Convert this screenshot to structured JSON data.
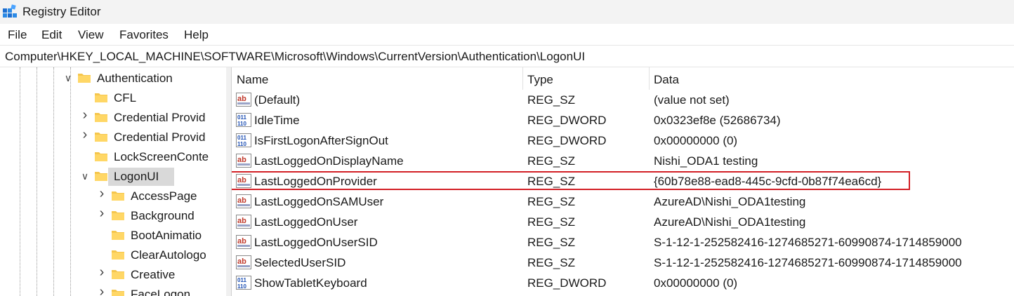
{
  "window": {
    "title": "Registry Editor"
  },
  "menu": [
    "File",
    "Edit",
    "View",
    "Favorites",
    "Help"
  ],
  "address": {
    "path": "Computer\\HKEY_LOCAL_MACHINE\\SOFTWARE\\Microsoft\\Windows\\CurrentVersion\\Authentication\\LogonUI"
  },
  "tree": {
    "items": [
      {
        "label": "Authentication",
        "expanded": true,
        "has_children": true,
        "level": 0,
        "selected": false
      },
      {
        "label": "CFL",
        "expanded": false,
        "has_children": false,
        "level": 1,
        "selected": false
      },
      {
        "label": "Credential Provid",
        "expanded": false,
        "has_children": true,
        "level": 1,
        "selected": false
      },
      {
        "label": "Credential Provid",
        "expanded": false,
        "has_children": true,
        "level": 1,
        "selected": false
      },
      {
        "label": "LockScreenConte",
        "expanded": false,
        "has_children": false,
        "level": 1,
        "selected": false
      },
      {
        "label": "LogonUI",
        "expanded": true,
        "has_children": true,
        "level": 1,
        "selected": true
      },
      {
        "label": "AccessPage",
        "expanded": false,
        "has_children": true,
        "level": 2,
        "selected": false
      },
      {
        "label": "Background",
        "expanded": false,
        "has_children": true,
        "level": 2,
        "selected": false
      },
      {
        "label": "BootAnimatio",
        "expanded": false,
        "has_children": false,
        "level": 2,
        "selected": false
      },
      {
        "label": "ClearAutologo",
        "expanded": false,
        "has_children": false,
        "level": 2,
        "selected": false
      },
      {
        "label": "Creative",
        "expanded": false,
        "has_children": true,
        "level": 2,
        "selected": false
      },
      {
        "label": "FaceLogon",
        "expanded": false,
        "has_children": true,
        "level": 2,
        "selected": false
      }
    ]
  },
  "list": {
    "columns": [
      "Name",
      "Type",
      "Data"
    ],
    "rows": [
      {
        "name": "(Default)",
        "type": "REG_SZ",
        "data": "(value not set)",
        "icon": "string-value-icon"
      },
      {
        "name": "IdleTime",
        "type": "REG_DWORD",
        "data": "0x0323ef8e (52686734)",
        "icon": "binary-value-icon"
      },
      {
        "name": "IsFirstLogonAfterSignOut",
        "type": "REG_DWORD",
        "data": "0x00000000 (0)",
        "icon": "binary-value-icon"
      },
      {
        "name": "LastLoggedOnDisplayName",
        "type": "REG_SZ",
        "data": "Nishi_ODA1 testing",
        "icon": "string-value-icon"
      },
      {
        "name": "LastLoggedOnProvider",
        "type": "REG_SZ",
        "data": "{60b78e88-ead8-445c-9cfd-0b87f74ea6cd}",
        "icon": "string-value-icon",
        "highlighted": true
      },
      {
        "name": "LastLoggedOnSAMUser",
        "type": "REG_SZ",
        "data": "AzureAD\\Nishi_ODA1testing",
        "icon": "string-value-icon"
      },
      {
        "name": "LastLoggedOnUser",
        "type": "REG_SZ",
        "data": "AzureAD\\Nishi_ODA1testing",
        "icon": "string-value-icon"
      },
      {
        "name": "LastLoggedOnUserSID",
        "type": "REG_SZ",
        "data": "S-1-12-1-252582416-1274685271-60990874-1714859000",
        "icon": "string-value-icon"
      },
      {
        "name": "SelectedUserSID",
        "type": "REG_SZ",
        "data": "S-1-12-1-252582416-1274685271-60990874-1714859000",
        "icon": "string-value-icon"
      },
      {
        "name": "ShowTabletKeyboard",
        "type": "REG_DWORD",
        "data": "0x00000000 (0)",
        "icon": "binary-value-icon"
      }
    ]
  },
  "colors": {
    "highlight_border": "#d32026",
    "selection": "#d9d9d9",
    "folder": "#f5c64d"
  }
}
